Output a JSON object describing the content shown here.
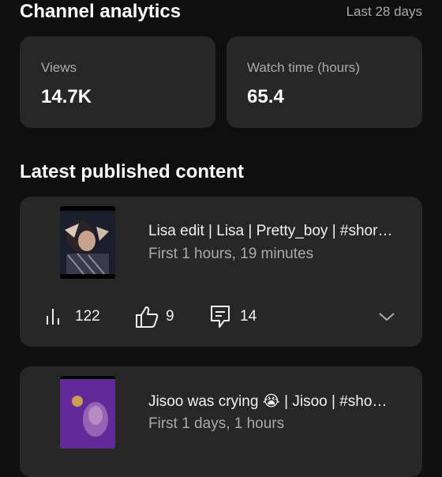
{
  "header": {
    "title": "Channel analytics",
    "range": "Last 28 days"
  },
  "stats": {
    "views_label": "Views",
    "views_value": "14.7K",
    "watch_label": "Watch time (hours)",
    "watch_value": "65.4"
  },
  "latest": {
    "heading": "Latest published content",
    "items": [
      {
        "title": "Lisa edit | Lisa | Pretty_boy | #shor…",
        "subtitle": "First 1 hours, 19 minutes",
        "views": "122",
        "likes": "9",
        "comments": "14",
        "thumb_icon": "lisa-thumbnail"
      },
      {
        "title": "Jisoo was crying 😭 | Jisoo | #sho…",
        "subtitle": "First 1 days, 1 hours",
        "thumb_icon": "jisoo-thumbnail"
      }
    ]
  },
  "colors": {
    "background": "#0f0f0f",
    "card": "#272727",
    "muted_text": "#aaaaaa"
  }
}
